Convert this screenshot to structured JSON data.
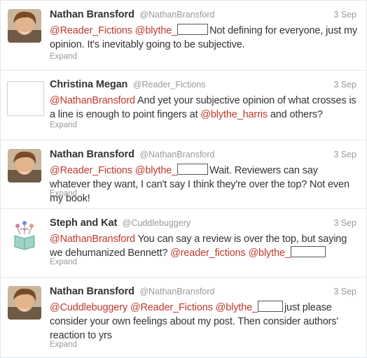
{
  "tweets": [
    {
      "name": "Nathan Bransford",
      "handle": "@NathanBransford",
      "time": "3 Sep",
      "mention1": "@Reader_Fictions",
      "mention2": "@blythe_",
      "text": "Not defining for everyone, just my opinion. It's inevitably going to be subjective.",
      "expand": "Expand"
    },
    {
      "name": "Christina Megan",
      "handle": "@Reader_Fictions",
      "time": "3 Sep",
      "mention1": "@NathanBransford",
      "text1": " And yet your subjective opinion of what crosses is a line is enough to point fingers at ",
      "mention2": "@blythe_harris",
      "text2": " and others?",
      "expand": "Expand"
    },
    {
      "name": "Nathan Bransford",
      "handle": "@NathanBransford",
      "time": "3 Sep",
      "mention1": "@Reader_Fictions",
      "mention2": "@blythe_",
      "text": "Wait. Reviewers can say whatever they want, I can't say I think they're over the top? Not even my book!",
      "expand": "Expand"
    },
    {
      "name": "Steph and Kat",
      "handle": "@Cuddlebuggery",
      "time": "3 Sep",
      "mention1": "@NathanBransford",
      "text1": " You can say a review is over the top, but saying we dehumanized Bennett? ",
      "mention2": "@reader_fictions",
      "mention3": "@blythe_",
      "expand": "Expand"
    },
    {
      "name": "Nathan Bransford",
      "handle": "@NathanBransford",
      "time": "3 Sep",
      "mention1": "@Cuddlebuggery",
      "mention2": "@Reader_Fictions",
      "mention3": "@blythe_",
      "text": "just please consider your own feelings about my post. Then consider authors' reaction to yrs",
      "expand": "Expand"
    }
  ],
  "colors": {
    "mention": "#c0392b",
    "meta": "#999999",
    "text": "#333333"
  }
}
